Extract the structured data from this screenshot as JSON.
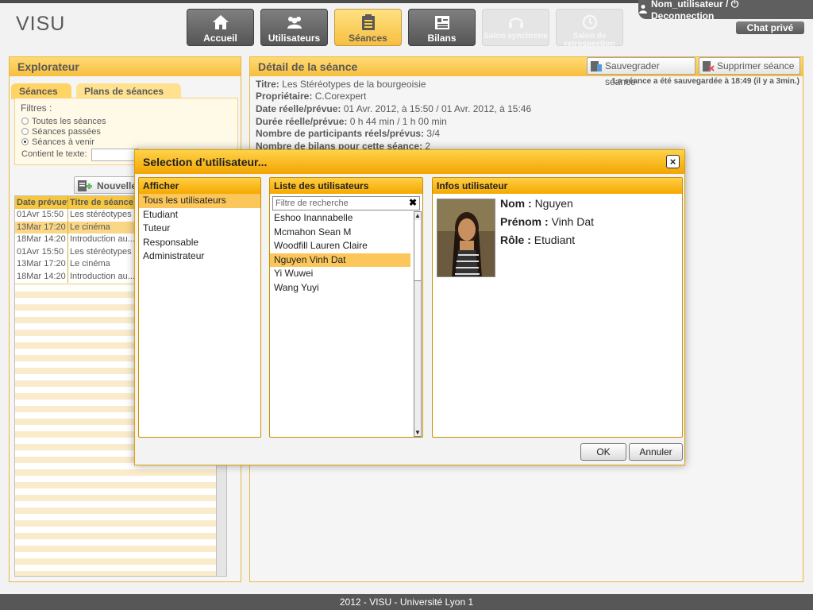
{
  "app": {
    "logo": "VISU",
    "user_link": "Nom_utilisateur / ⏻ Deconnection",
    "chat": "Chat privé",
    "footer": "2012 - VISU - Université Lyon 1"
  },
  "nav": {
    "accueil": "Accueil",
    "utilisateurs": "Utilisateurs",
    "seances": "Séances",
    "bilans": "Bilans",
    "salon_sync": "Salon synchrone",
    "salon_retro": "Salon de retrospection"
  },
  "explorer": {
    "title": "Explorateur",
    "tab1": "Séances",
    "tab2": "Plans de séances",
    "filters_title": "Filtres :",
    "filter_all": "Toutes les séances",
    "filter_past": "Séances passées",
    "filter_future": "Séances à venir",
    "contains_label": "Contient le texte:",
    "new_btn": "Nouvelle",
    "col_date": "Date prévue▾",
    "col_title": "Titre de séance",
    "rows": [
      {
        "date": "01Avr 15:50",
        "title": "Les stéréotypes"
      },
      {
        "date": "13Mar 17:20",
        "title": "Le cinéma"
      },
      {
        "date": "18Mar 14:20",
        "title": "Introduction au..."
      },
      {
        "date": "01Avr 15:50",
        "title": "Les stéréotypes"
      },
      {
        "date": "13Mar 17:20",
        "title": "Le cinéma"
      },
      {
        "date": "18Mar 14:20",
        "title": "Introduction au..."
      }
    ]
  },
  "detail": {
    "title": "Détail de la séance",
    "save_btn": "Sauvegrader séance",
    "delete_btn": "Supprimer séance",
    "saved_note": "La séance a été sauvegardée à 18:49 (il y a 3min.)",
    "titre_label": "Titre:",
    "titre_value": "Les Stéréotypes de la bourgeoisie",
    "owner_label": "Propriétaire:",
    "owner_value": "C.Corexpert",
    "date_label": "Date réelle/prévue:",
    "date_value": "01 Avr. 2012, à 15:50 / 01 Avr. 2012, à 15:46",
    "duree_label": "Durée réelle/prévue:",
    "duree_value": "0 h 44 min / 1 h 00 min",
    "participants_label": "Nombre de participants réels/prévus:",
    "participants_value": "3/4",
    "bilans_label": "Nombre de bilans pour cette séance:",
    "bilans_value": "2"
  },
  "dialog": {
    "title": "Selection d’utilisateur...",
    "close": "×",
    "afficher": {
      "title": "Afficher",
      "options": [
        "Tous les utilisateurs",
        "Etudiant",
        "Tuteur",
        "Responsable",
        "Administrateur"
      ]
    },
    "liste": {
      "title": "Liste des utilisateurs",
      "placeholder": "Filtre de recherche",
      "users": [
        "Eshoo Inannabelle",
        "Mcmahon Sean M",
        "Woodfill Lauren Claire",
        "Nguyen Vinh Dat",
        "Yi Wuwei",
        "Wang Yuyi"
      ]
    },
    "infos": {
      "title": "Infos utilisateur",
      "nom_label": "Nom :",
      "nom_value": "Nguyen",
      "prenom_label": "Prénom :",
      "prenom_value": "Vinh Dat",
      "role_label": "Rôle :",
      "role_value": "Etudiant"
    },
    "ok": "OK",
    "cancel": "Annuler"
  }
}
